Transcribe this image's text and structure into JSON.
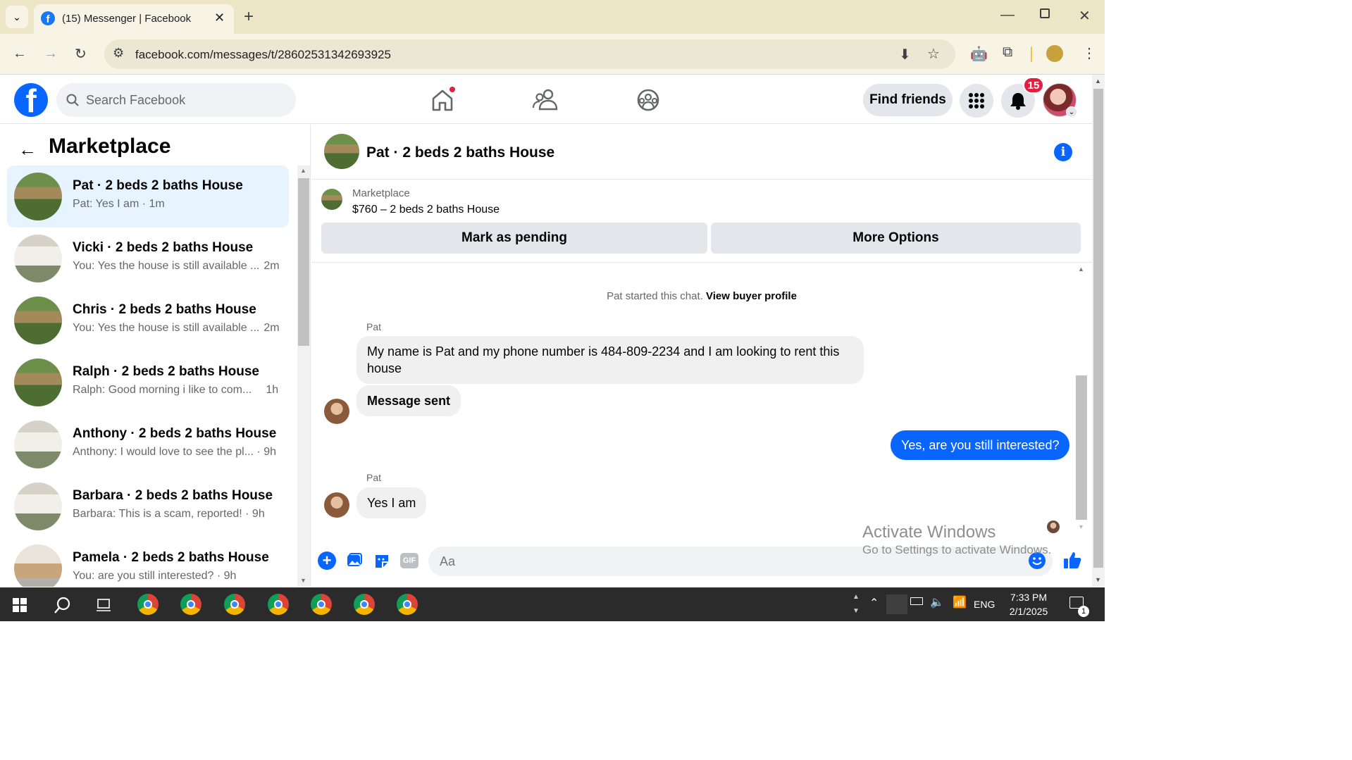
{
  "browser": {
    "tab_title": "(15) Messenger | Facebook",
    "url": "facebook.com/messages/t/28602531342693925",
    "new_tab_label": "+",
    "back_icon": "back-arrow-icon",
    "forward_icon": "forward-arrow-icon",
    "reload_icon": "reload-icon"
  },
  "fb_header": {
    "logo": "f",
    "search_placeholder": "Search Facebook",
    "find_friends_label": "Find friends",
    "notifications_count": "15",
    "brand_color": "#0866ff"
  },
  "left_panel": {
    "title": "Marketplace",
    "conversations": [
      {
        "name": "Pat · 2 beds 2 baths House",
        "preview": "Pat: Yes I am · 1m",
        "time": "",
        "active": true
      },
      {
        "name": "Vicki · 2 beds 2 baths House",
        "preview": "You: Yes the house is still available ...",
        "time": "2m"
      },
      {
        "name": "Chris · 2 beds 2 baths House",
        "preview": "You: Yes the house is still available ...",
        "time": "2m"
      },
      {
        "name": "Ralph · 2 beds 2 baths House",
        "preview": "Ralph: Good morning i like to com...",
        "time": "1h"
      },
      {
        "name": "Anthony · 2 beds 2 baths House",
        "preview": "Anthony: I would love to see the pl... · 9h",
        "time": ""
      },
      {
        "name": "Barbara · 2 beds 2 baths House",
        "preview": "Barbara: This is a scam, reported! · 9h",
        "time": ""
      },
      {
        "name": "Pamela · 2 beds 2 baths House",
        "preview": "You: are you still interested? · 9h",
        "time": ""
      }
    ]
  },
  "chat": {
    "title": "Pat · 2 beds 2 baths House",
    "marketplace_label": "Marketplace",
    "listing": "$760 – 2 beds 2 baths House",
    "mark_pending_label": "Mark as pending",
    "more_options_label": "More Options",
    "started_text": "Pat started this chat.",
    "view_profile_label": "View buyer profile",
    "messages": [
      {
        "sender": "Pat",
        "text": "My name is Pat and my phone number is 484-809-2234 and I am looking to rent this house"
      },
      {
        "sender": "",
        "text": "Message sent"
      },
      {
        "sender": "me",
        "text": "Yes, are you still interested?"
      },
      {
        "sender": "Pat",
        "text": "Yes I am"
      }
    ],
    "composer_placeholder": "Aa",
    "gif_label": "GIF"
  },
  "watermark": {
    "line1": "Activate Windows",
    "line2": "Go to Settings to activate Windows."
  },
  "taskbar": {
    "language": "ENG",
    "time": "7:33 PM",
    "date": "2/1/2025",
    "notification_count": "1"
  }
}
